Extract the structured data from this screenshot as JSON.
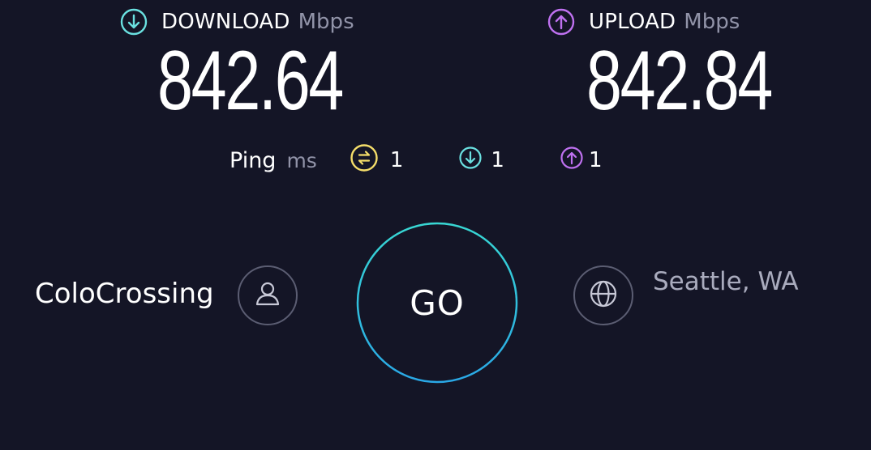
{
  "download": {
    "label": "DOWNLOAD",
    "unit": "Mbps",
    "value": "842.64",
    "icon": "arrow-down-circle-icon",
    "color": "#6ae0e0"
  },
  "upload": {
    "label": "UPLOAD",
    "unit": "Mbps",
    "value": "842.84",
    "icon": "arrow-up-circle-icon",
    "color": "#bf71f0"
  },
  "ping": {
    "label": "Ping",
    "unit": "ms",
    "idle": {
      "value": "1",
      "icon": "jitter-icon",
      "color": "#f5de6a"
    },
    "download": {
      "value": "1",
      "icon": "arrow-down-circle-icon",
      "color": "#6ae0e0"
    },
    "upload": {
      "value": "1",
      "icon": "arrow-up-circle-icon",
      "color": "#bf71f0"
    }
  },
  "provider": {
    "name": "ColoCrossing",
    "icon": "user-icon"
  },
  "server": {
    "location": "Seattle, WA",
    "icon": "globe-icon"
  },
  "go_button": {
    "label": "GO"
  },
  "colors": {
    "background": "#141526",
    "ring_start": "#38d7d3",
    "ring_end": "#2aa8e6",
    "muted_text": "#9193a8"
  }
}
